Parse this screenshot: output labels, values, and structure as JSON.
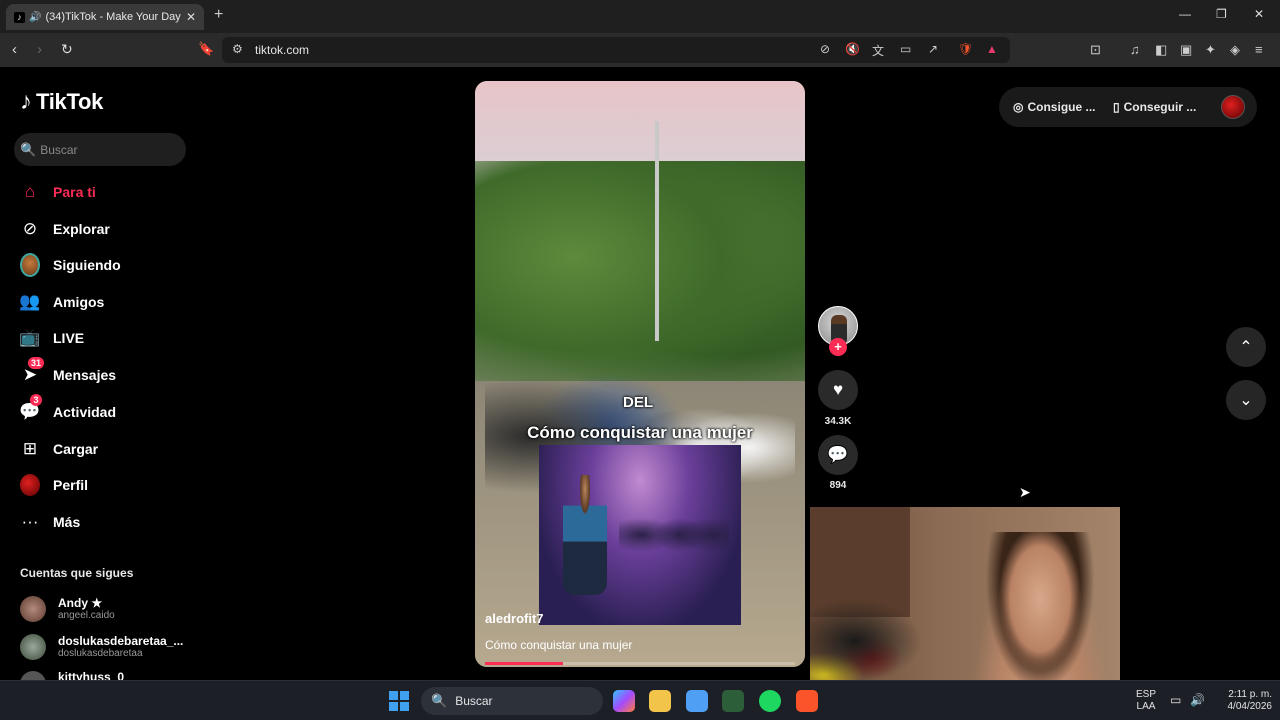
{
  "browser": {
    "tab_title": "(34)TikTok - Make Your Day",
    "url": "tiktok.com",
    "extension_badge": "1"
  },
  "tiktok": {
    "logo_text": "TikTok",
    "search_placeholder": "Buscar",
    "nav": [
      {
        "label": "Para ti",
        "icon": "home-icon",
        "active": true
      },
      {
        "label": "Explorar",
        "icon": "compass-icon"
      },
      {
        "label": "Siguiendo",
        "icon": "following-avatar"
      },
      {
        "label": "Amigos",
        "icon": "friends-icon"
      },
      {
        "label": "LIVE",
        "icon": "live-tv-icon"
      },
      {
        "label": "Mensajes",
        "icon": "send-icon",
        "badge": "31"
      },
      {
        "label": "Actividad",
        "icon": "activity-icon",
        "badge": "3"
      },
      {
        "label": "Cargar",
        "icon": "upload-plus-icon"
      },
      {
        "label": "Perfil",
        "icon": "profile-avatar"
      },
      {
        "label": "Más",
        "icon": "more-dots-icon"
      }
    ],
    "following_section_title": "Cuentas que sigues",
    "following_accounts": [
      {
        "name": "Andy ★",
        "handle": "angeel.caido"
      },
      {
        "name": "doslukasdebaretaa_...",
        "handle": "doslukasdebaretaa"
      },
      {
        "name": "kittyhuss_0",
        "handle": ""
      }
    ],
    "header_buttons": [
      {
        "label": "Consigue ...",
        "icon": "coin-icon"
      },
      {
        "label": "Conseguir ...",
        "icon": "phone-icon"
      }
    ],
    "video": {
      "overlay_word": "DEL",
      "overlay_title": "Cómo conquistar una mujer",
      "author": "aledrofit7",
      "description": "Cómo conquistar una mujer",
      "progress": 0.25
    },
    "actions": {
      "likes": "34.3K",
      "comments": "894"
    }
  },
  "taskbar": {
    "search_placeholder": "Buscar",
    "language_line1": "ESP",
    "language_line2": "LAA",
    "time": "2:11 p. m.",
    "date": "4/04/2026"
  },
  "colors": {
    "accent": "#fe2c55",
    "background": "#000000",
    "chrome": "#2b2b2b"
  }
}
